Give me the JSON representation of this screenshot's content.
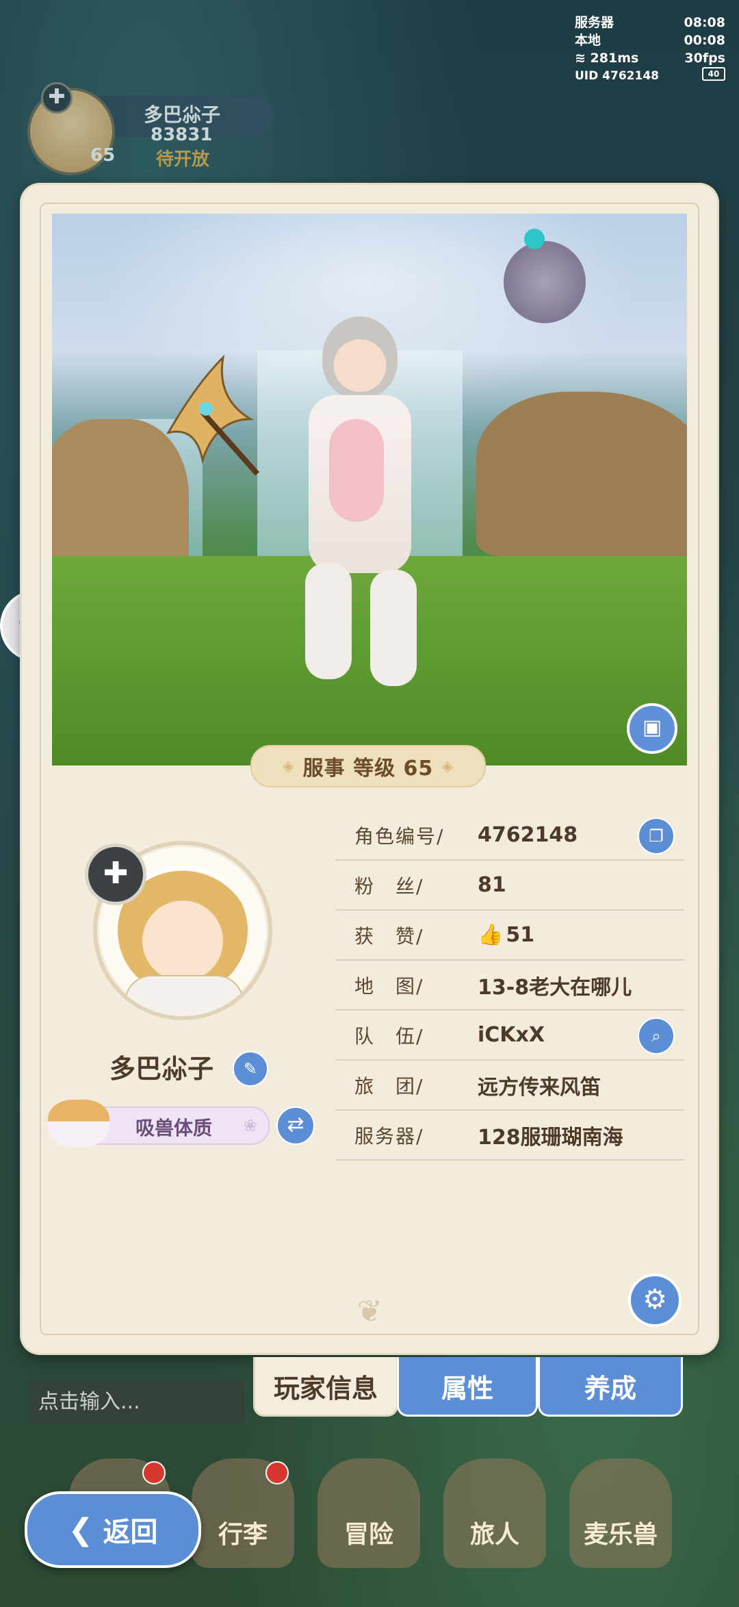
{
  "status": {
    "server_label": "服务器",
    "server_time": "08:08",
    "local_label": "本地",
    "local_time": "00:08",
    "ping": "281ms",
    "fps": "30fps",
    "uid_label": "UID",
    "uid": "4762148",
    "battery": "40"
  },
  "topbar": {
    "name": "多巴尛子",
    "score": "83831",
    "level": "65",
    "state": "待开放"
  },
  "level_ribbon": "服事 等级 65",
  "player": {
    "name": "多巴尛子",
    "trait": "吸兽体质"
  },
  "info": [
    {
      "key": "角色编号/",
      "value": "4762148"
    },
    {
      "key": "粉　丝/",
      "value": "81"
    },
    {
      "key": "获　赞/",
      "value": "51"
    },
    {
      "key": "地　图/",
      "value": "13-8老大在哪儿"
    },
    {
      "key": "队　伍/",
      "value": "iCKxX"
    },
    {
      "key": "旅　团/",
      "value": "远方传来风笛"
    },
    {
      "key": "服务器/",
      "value": "128服珊瑚南海"
    }
  ],
  "tabs": [
    "玩家信息",
    "属性",
    "养成"
  ],
  "chat_placeholder": "点击输入...",
  "nav": [
    "行李",
    "冒险",
    "旅人",
    "麦乐兽"
  ],
  "back_label": "返回",
  "colors": {
    "accent": "#5c8ed6",
    "card": "#f3ecdd",
    "text": "#4d3a28"
  }
}
